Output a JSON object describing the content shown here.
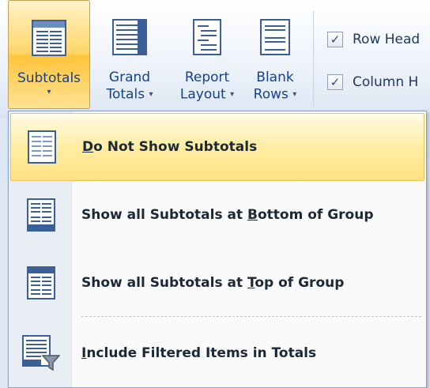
{
  "ribbon": {
    "subtotals": {
      "label": "Subtotals",
      "arrow": "▾",
      "icon": "subtotals-icon"
    },
    "grand_totals": {
      "label_line1": "Grand",
      "label_line2": "Totals",
      "arrow": "▾",
      "icon": "grand-totals-icon"
    },
    "report_layout": {
      "label_line1": "Report",
      "label_line2": "Layout",
      "arrow": "▾",
      "icon": "report-layout-icon"
    },
    "blank_rows": {
      "label_line1": "Blank",
      "label_line2": "Rows",
      "arrow": "▾",
      "icon": "blank-rows-icon"
    },
    "row_headers": {
      "label": "Row Head",
      "checked": true
    },
    "column_headers": {
      "label": "Column H",
      "checked": true
    },
    "check_mark": "✓"
  },
  "menu": {
    "items": [
      {
        "before": "",
        "mnemonic": "D",
        "after": "o Not Show Subtotals",
        "highlighted": true,
        "icon": "no-subtotals-icon"
      },
      {
        "before": "Show all Subtotals at ",
        "mnemonic": "B",
        "after": "ottom of Group",
        "highlighted": false,
        "icon": "subtotals-bottom-icon"
      },
      {
        "before": "Show all Subtotals at ",
        "mnemonic": "T",
        "after": "op of Group",
        "highlighted": false,
        "icon": "subtotals-top-icon"
      },
      {
        "before": "",
        "mnemonic": "I",
        "after": "nclude Filtered Items in Totals",
        "highlighted": false,
        "icon": "filtered-items-icon"
      }
    ]
  },
  "colors": {
    "highlight": "#ffe283",
    "ribbon_text": "#15428b",
    "accent_icon": "#3c5f97"
  }
}
